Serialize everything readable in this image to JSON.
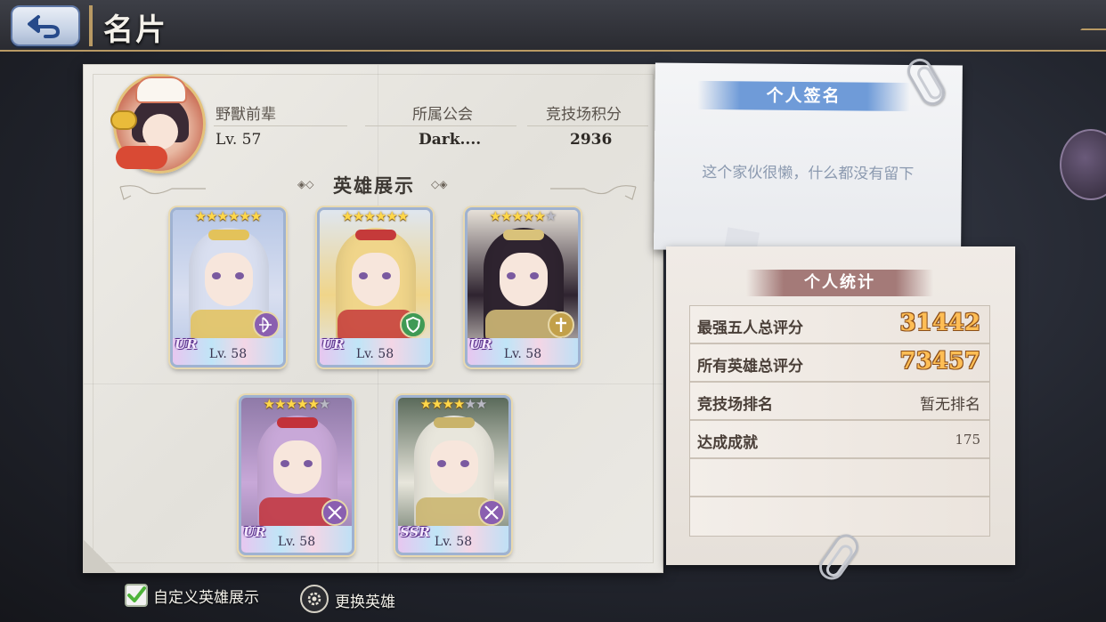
{
  "header": {
    "title": "名片"
  },
  "profile": {
    "name": "野獸前辈",
    "level": "Lv. 57",
    "guild_label": "所属公会",
    "guild_value": "Dark....",
    "arena_label": "竞技场积分",
    "arena_value": "2936"
  },
  "hero_section": {
    "title": "英雄展示",
    "heroes": [
      {
        "rarity": "UR",
        "level": "Lv. 58",
        "stars": 6,
        "max_stars": 6,
        "class_icon": "bow-icon",
        "colors": {
          "hair": "#d9dff0",
          "bg": "#b7c7e6",
          "accent": "#e3c25a"
        }
      },
      {
        "rarity": "UR",
        "level": "Lv. 58",
        "stars": 6,
        "max_stars": 6,
        "class_icon": "shield-icon",
        "colors": {
          "hair": "#f0d58a",
          "bg": "#dfe6ef",
          "accent": "#c53a3a"
        }
      },
      {
        "rarity": "UR",
        "level": "Lv. 58",
        "stars": 5,
        "max_stars": 6,
        "class_icon": "cross-icon",
        "colors": {
          "hair": "#2f2430",
          "bg": "#e6e0d8",
          "accent": "#d9c27a"
        }
      },
      {
        "rarity": "UR",
        "level": "Lv. 58",
        "stars": 5,
        "max_stars": 6,
        "class_icon": "swords-icon",
        "colors": {
          "hair": "#c8a8d8",
          "bg": "#8f7aa8",
          "accent": "#c2323a"
        }
      },
      {
        "rarity": "SSR",
        "level": "Lv. 58",
        "stars": 4,
        "max_stars": 6,
        "class_icon": "swords-icon",
        "colors": {
          "hair": "#e8e6dc",
          "bg": "#5a6a5a",
          "accent": "#c9b36a"
        }
      }
    ]
  },
  "controls": {
    "custom_display_label": "自定义英雄展示",
    "custom_display_checked": true,
    "change_hero_label": "更换英雄"
  },
  "signature": {
    "title": "个人签名",
    "text": "这个家伙很懒，什么都没有留下"
  },
  "stats": {
    "title": "个人统计",
    "rows": [
      {
        "label": "最强五人总评分",
        "value": "31442"
      },
      {
        "label": "所有英雄总评分",
        "value": "73457"
      },
      {
        "label": "竞技场排名",
        "value": "暂无排名"
      },
      {
        "label": "达成成就",
        "value": "175"
      },
      {
        "label": "",
        "value": ""
      },
      {
        "label": "",
        "value": ""
      }
    ]
  },
  "theme": {
    "accent_gold": "#b99a64",
    "score_orange": "#ffbe55",
    "signature_blue": "#6f9bd8",
    "stats_rose": "#a47a78"
  }
}
